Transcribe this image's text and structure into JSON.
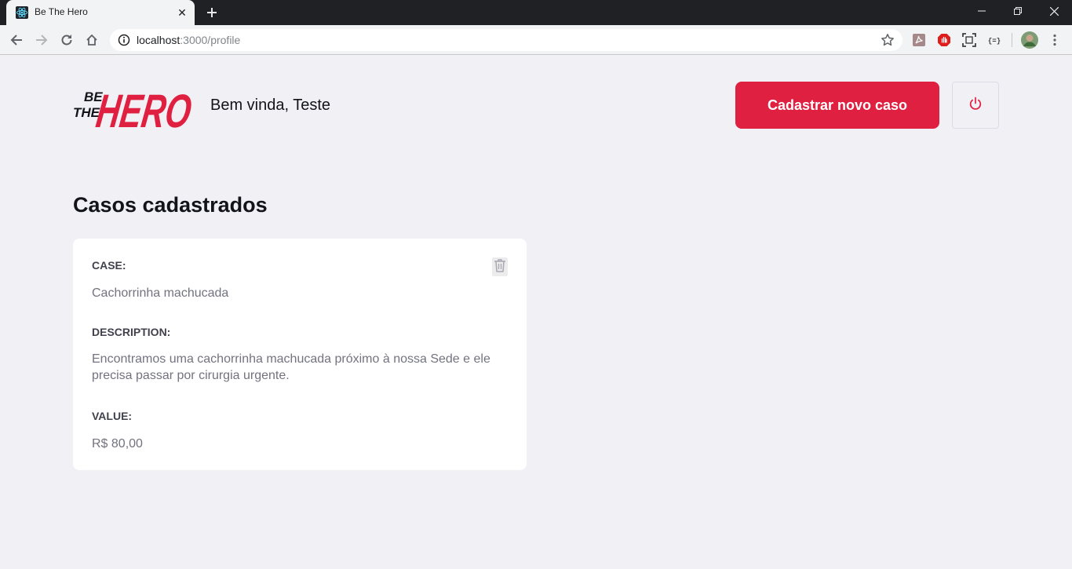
{
  "browser": {
    "tab_title": "Be The Hero",
    "url_host": "localhost",
    "url_rest": ":3000/profile"
  },
  "header": {
    "logo_line1": "BE",
    "logo_line2": "THE",
    "logo_word": "HERO",
    "welcome": "Bem vinda, Teste",
    "new_case_button": "Cadastrar novo caso"
  },
  "section_title": "Casos cadastrados",
  "cases": [
    {
      "case_label": "CASE:",
      "case_value": "Cachorrinha machucada",
      "description_label": "DESCRIPTION:",
      "description_value": "Encontramos uma cachorrinha machucada próximo à nossa Sede e ele precisa passar por cirurgia urgente.",
      "value_label": "VALUE:",
      "value_value": "R$ 80,00"
    }
  ],
  "colors": {
    "brand": "#e02041",
    "background": "#f0f0f5",
    "card": "#ffffff"
  },
  "icons": [
    "react-favicon-icon",
    "close-icon",
    "plus-icon",
    "back-icon",
    "forward-icon",
    "reload-icon",
    "home-icon",
    "info-icon",
    "star-icon",
    "pdf-extension-icon",
    "adblock-extension-icon",
    "screenshot-extension-icon",
    "json-extension-icon",
    "avatar",
    "menu-icon",
    "power-icon",
    "trash-icon"
  ]
}
